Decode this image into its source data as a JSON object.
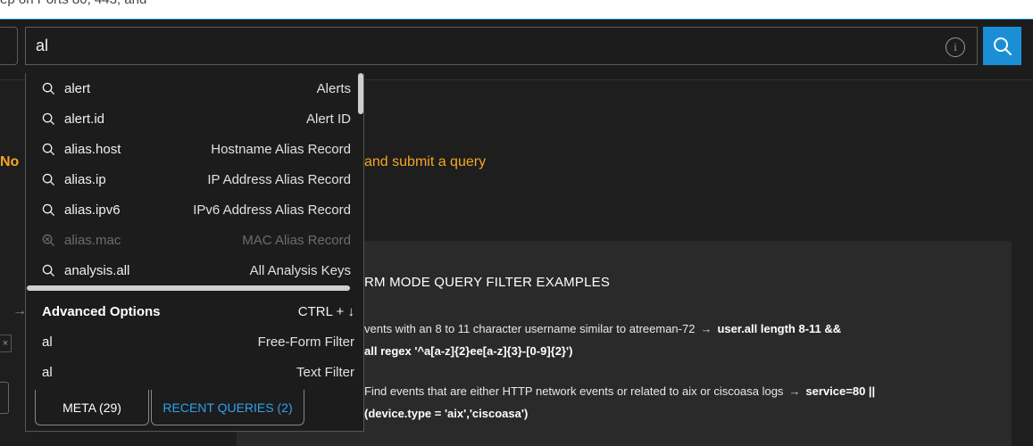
{
  "top_fragment": "ep on Ports 80, 443, and",
  "search": {
    "value": "al",
    "search_icon": "search-icon",
    "info_icon": "info-icon"
  },
  "page": {
    "no_text": "No",
    "submit_text": "and submit a query"
  },
  "dropdown": {
    "suggestions": [
      {
        "key": "alert",
        "desc": "Alerts",
        "disabled": false
      },
      {
        "key": "alert.id",
        "desc": "Alert ID",
        "disabled": false
      },
      {
        "key": "alias.host",
        "desc": "Hostname Alias Record",
        "disabled": false
      },
      {
        "key": "alias.ip",
        "desc": "IP Address Alias Record",
        "disabled": false
      },
      {
        "key": "alias.ipv6",
        "desc": "IPv6 Address Alias Record",
        "disabled": false
      },
      {
        "key": "alias.mac",
        "desc": "MAC Alias Record",
        "disabled": true
      },
      {
        "key": "analysis.all",
        "desc": "All Analysis Keys",
        "disabled": false
      }
    ],
    "advanced": {
      "title": "Advanced Options",
      "shortcut": "CTRL + ↓",
      "items": [
        {
          "value": "al",
          "desc": "Free-Form Filter"
        },
        {
          "value": "al",
          "desc": "Text Filter"
        }
      ]
    },
    "tabs": {
      "meta": "META (29)",
      "recent": "RECENT QUERIES (2)"
    }
  },
  "examples": {
    "title": "RM MODE QUERY FILTER EXAMPLES",
    "lines": [
      {
        "text": "vents with an 8 to 11 character username similar to atreeman-72",
        "arrow": "→",
        "query": "user.all length 8-11 &&"
      },
      {
        "text": "",
        "arrow": "",
        "query": "all regex '^a[a-z]{2}ee[a-z]{3}-[0-9]{2}')"
      },
      {
        "text": "Find events that are either HTTP network events or related to aix or ciscoasa logs",
        "arrow": "→",
        "query": "service=80 ||"
      },
      {
        "text": "",
        "arrow": "",
        "query": "(device.type = 'aix','ciscoasa')"
      }
    ]
  },
  "colors": {
    "accent": "#1a8fd6",
    "warning": "#f5a623",
    "recent_tab": "#2ea3ec"
  }
}
